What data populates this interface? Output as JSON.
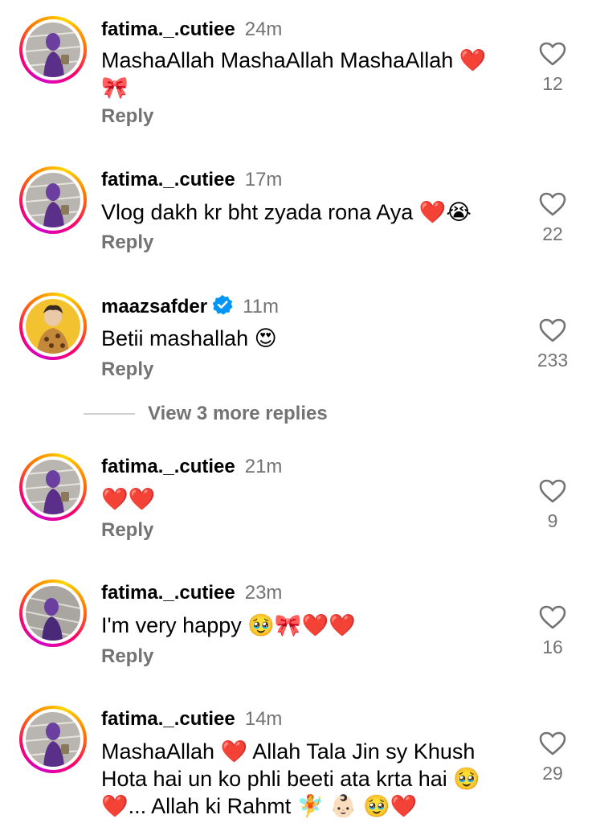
{
  "colors": {
    "muted_text": "#737373",
    "verified_blue": "#0095f6",
    "story_ring": [
      "#d300c5",
      "#ff0069",
      "#ff7a00",
      "#ffd600"
    ]
  },
  "comments": [
    {
      "username": "fatima._.cutiee",
      "time": "24m",
      "text": "MashaAllah MashaAllah MashaAllah ❤️ 🎀",
      "reply_label": "Reply",
      "likes": "12",
      "verified": false,
      "icon": "heart-outline-icon"
    },
    {
      "username": "fatima._.cutiee",
      "time": "17m",
      "text": "Vlog dakh kr bht zyada rona Aya ❤️😭",
      "reply_label": "Reply",
      "likes": "22",
      "verified": false,
      "icon": "heart-outline-icon"
    },
    {
      "username": "maazsafder",
      "time": "11m",
      "text": "Betii mashallah 😍",
      "reply_label": "Reply",
      "likes": "233",
      "verified": true,
      "icon": "heart-outline-icon"
    },
    {
      "username": "fatima._.cutiee",
      "time": "21m",
      "text": "❤️❤️",
      "reply_label": "Reply",
      "likes": "9",
      "verified": false,
      "icon": "heart-outline-icon"
    },
    {
      "username": "fatima._.cutiee",
      "time": "23m",
      "text": "I'm very happy 🥹🎀❤️❤️",
      "reply_label": "Reply",
      "likes": "16",
      "verified": false,
      "icon": "heart-outline-icon"
    },
    {
      "username": "fatima._.cutiee",
      "time": "14m",
      "text": "MashaAllah ❤️ Allah Tala Jin sy Khush Hota hai un ko phli beeti ata krta hai 🥹 ❤️... Allah ki Rahmt 🧚 👶🏻 🥹❤️",
      "reply_label": "",
      "likes": "29",
      "verified": false,
      "icon": "heart-outline-icon"
    }
  ],
  "view_more_replies": "View 3 more replies"
}
